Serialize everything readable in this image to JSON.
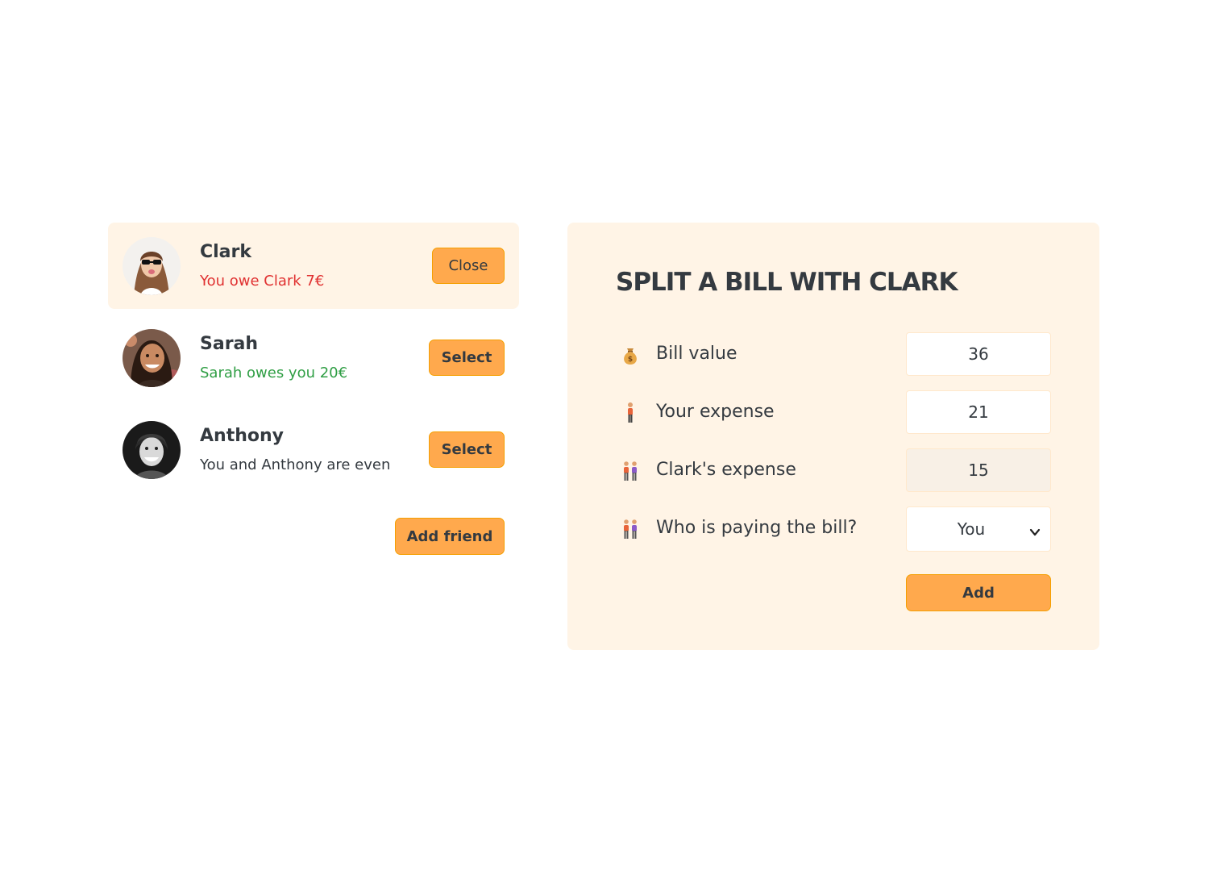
{
  "friends": [
    {
      "name": "Clark",
      "status": "You owe Clark 7€",
      "button_label": "Close"
    },
    {
      "name": "Sarah",
      "status": "Sarah owes you 20€",
      "button_label": "Select"
    },
    {
      "name": "Anthony",
      "status": "You and Anthony are even",
      "button_label": "Select"
    }
  ],
  "add_friend_label": "Add friend",
  "split_form": {
    "title": "SPLIT A BILL WITH CLARK",
    "bill_value": {
      "label": "Bill value",
      "icon": "money-bag-icon",
      "value": "36"
    },
    "your_expense": {
      "label": "Your expense",
      "icon": "person-icon",
      "value": "21"
    },
    "friend_expense": {
      "label": "Clark's expense",
      "icon": "people-icon",
      "value": "15"
    },
    "payer": {
      "label": "Who is paying the bill?",
      "icon": "people-icon",
      "selected": "You"
    },
    "submit_label": "Add"
  },
  "colors": {
    "accent": "#ffa94d",
    "panel": "#fff4e6",
    "owe": "#e03131",
    "owed": "#2f9e44",
    "text": "#343a40"
  }
}
